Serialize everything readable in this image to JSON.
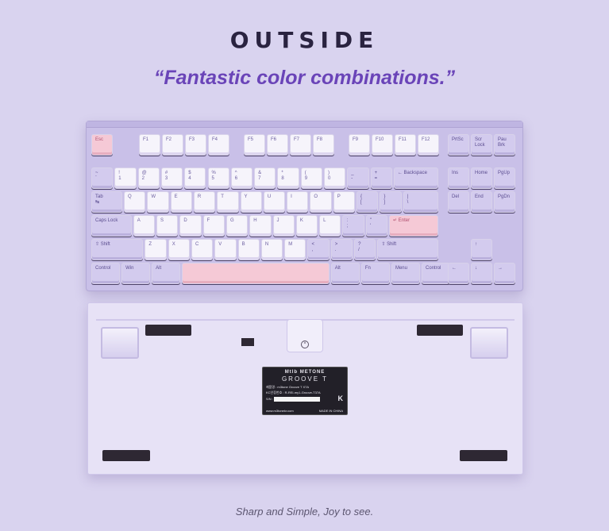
{
  "heading": "OUTSIDE",
  "tagline": "“Fantastic color combinations.”",
  "caption": "Sharp and Simple, Joy to see.",
  "colors": {
    "background": "#d9d3ef",
    "accent": "#6a44b8",
    "case": "#c9c0e8",
    "pink_keys": "#f5c9d6"
  },
  "keyboard": {
    "fn_row": [
      "Esc",
      "F1",
      "F2",
      "F3",
      "F4",
      "F5",
      "F6",
      "F7",
      "F8",
      "F9",
      "F10",
      "F11",
      "F12",
      "PrtSc",
      "Scr\nLock",
      "Pau\nBrk"
    ],
    "num_row": [
      "~\n`",
      "!\n1",
      "@\n2",
      "#\n3",
      "$\n4",
      "%\n5",
      "^\n6",
      "&\n7",
      "*\n8",
      "(\n9",
      ")\n0",
      "_\n-",
      "+\n=",
      "← Backspace",
      "Ins",
      "Home",
      "PgUp"
    ],
    "tab_row": [
      "Tab\n↹",
      "Q",
      "W",
      "E",
      "R",
      "T",
      "Y",
      "U",
      "I",
      "O",
      "P",
      "{\n[",
      "}\n]",
      "|\n\\",
      "Del",
      "End",
      "PgDn"
    ],
    "caps_row": [
      "Caps Lock",
      "A",
      "S",
      "D",
      "F",
      "G",
      "H",
      "J",
      "K",
      "L",
      ":\n;",
      "\"\n'",
      "↵ Enter"
    ],
    "shift_row": [
      "⇧ Shift",
      "Z",
      "X",
      "C",
      "V",
      "B",
      "N",
      "M",
      "<\n,",
      ">\n.",
      "?\n/",
      "⇧ Shift",
      "↑"
    ],
    "bottom_row": [
      "Control",
      "Win",
      "Alt",
      "",
      "Alt",
      "Fn",
      "Menu",
      "Control",
      "←",
      "↓",
      "→"
    ]
  },
  "bottom_label": {
    "brand": "Mtlb METONE",
    "model": "GROOVE T",
    "line1": "제품명 : m3tone Groove T X7A",
    "line2": "KC인증번호 : R-REI-my1-Groove-T37A",
    "serial_label": "S/N :",
    "site": "www.m3tonekr.com",
    "origin": "MADE IN CHINA",
    "mark": "K"
  }
}
